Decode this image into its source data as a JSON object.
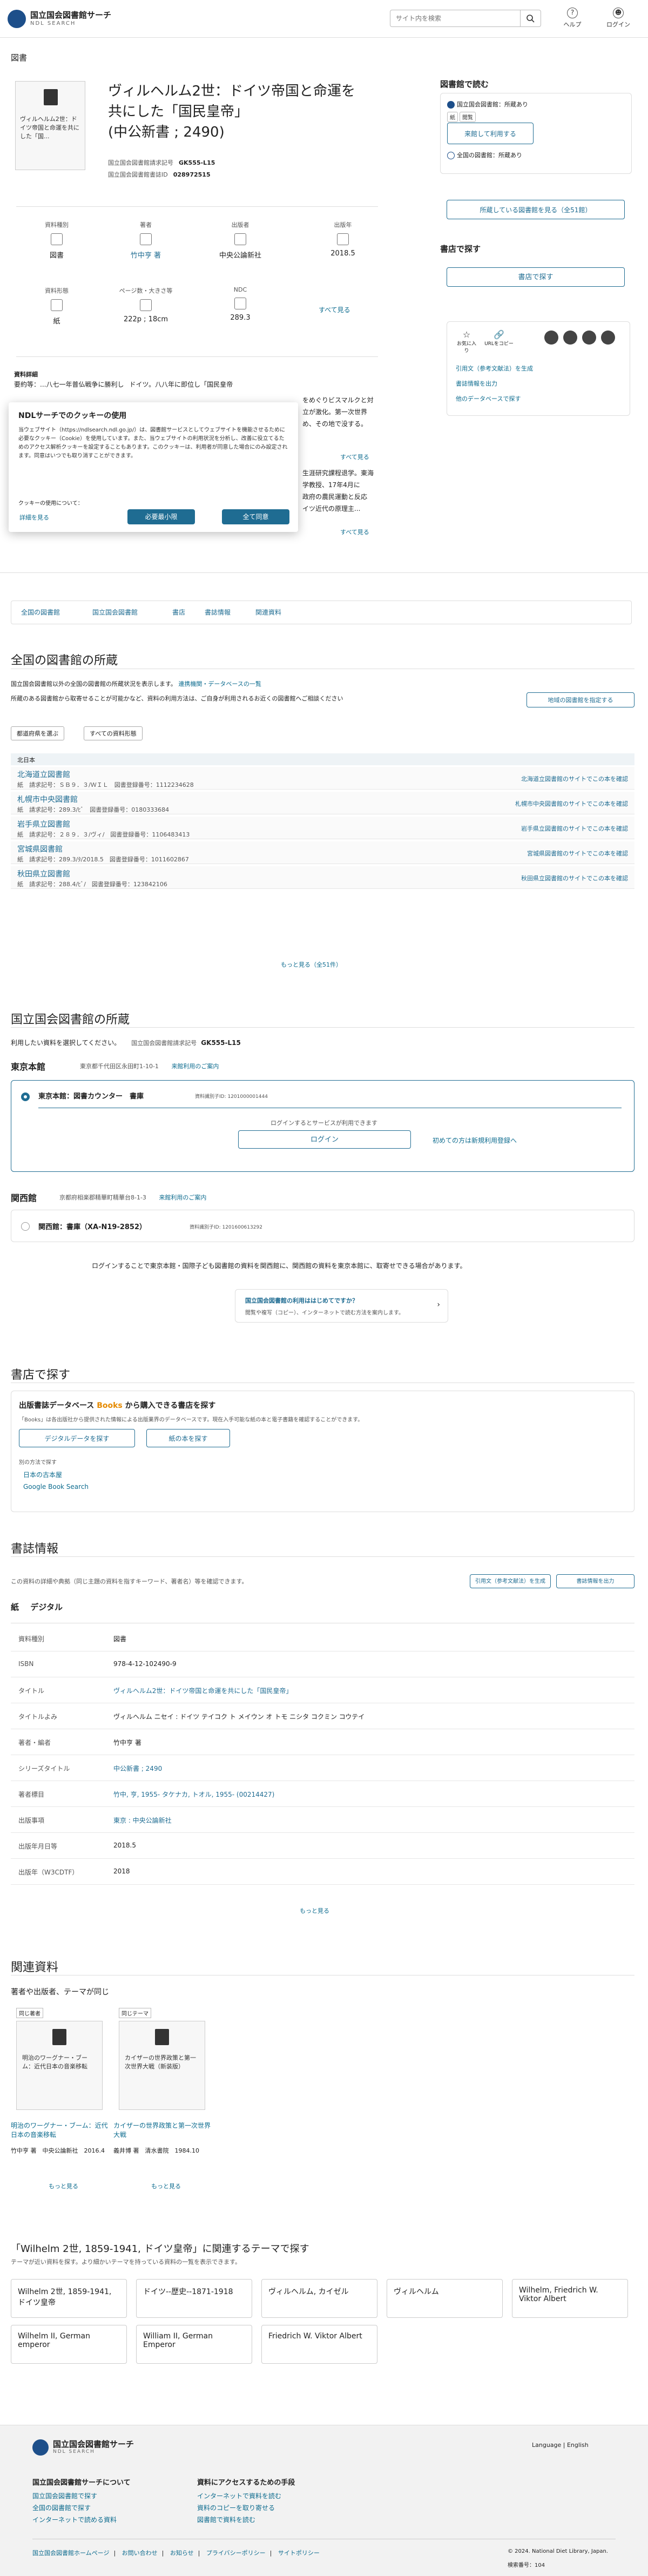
{
  "header": {
    "logo_jp": "国立国会図書館サーチ",
    "logo_en": "NDL SEARCH",
    "search_placeholder": "サイト内を検索",
    "help": "ヘルプ",
    "login": "ログイン"
  },
  "breadcrumb": "図書",
  "item": {
    "thumb_text": "ヴィルヘルム2世：ドイツ帝国と命運を共にした「国...",
    "title_l1": "ヴィルヘルム2世：ドイツ帝国と命運を",
    "title_l2": "共にした「国民皇帝」",
    "title_l3": "(中公新書 ; 2490)",
    "call_label": "国立国会図書館請求記号",
    "call_value": "GK555-L15",
    "ndlid_label": "国立国会図書館書誌ID",
    "ndlid_value": "028972515"
  },
  "info": [
    {
      "label": "資料種別",
      "value": "図書"
    },
    {
      "label": "著者",
      "value": "竹中亨 著"
    },
    {
      "label": "出版者",
      "value": "中央公論新社"
    },
    {
      "label": "出版年",
      "value": "2018.5"
    },
    {
      "label": "資料形態",
      "value": "紙"
    },
    {
      "label": "ページ数・大きさ等",
      "value": "222p ; 18cm"
    },
    {
      "label": "NDC",
      "value": "289.3"
    }
  ],
  "show_all": "すべて見る",
  "abstract": {
    "label": "資料詳細",
    "text1": "要約等：",
    "text2": "...八七一年普仏戦争に勝利し",
    "text3": "ドイツ。八八年に即位し「国民皇帝",
    "r1": "をめぐりビスマルクと対",
    "r2": "立が激化。第一次世界",
    "r3": "め、その地で没する。",
    "more1": "すべて見る",
    "r4": "生涯研究課程退学。東海",
    "r5": "学教授、17年4月に",
    "r6": "政府の農民運動と反応",
    "r7": "イツ近代の原理主...",
    "more2": "すべて見る"
  },
  "cookie": {
    "title": "NDLサーチでのクッキーの使用",
    "body": "当ウェブサイト（https://ndlsearch.ndl.go.jp/）は、図書館サービスとしてウェブサイトを機能させるために必要なクッキー（Cookie）を使用しています。また、当ウェブサイトの利用状況を分析し、改善に役立てるためのアクセス解析クッキーを設定することもあります。このクッキーは、利用者が同意した場合にのみ設定されます。同意はいつでも取り消すことができます。",
    "usage": "クッキーの使用について：",
    "detail": "詳細を見る",
    "necessary": "必要最小限",
    "accept": "全て同意"
  },
  "side": {
    "read_title": "図書館で読む",
    "ndl_label": "国立国会図書館：所蔵あり",
    "tags": [
      "紙",
      "閲覧"
    ],
    "ndl_btn": "来館して利用する",
    "pub_label": "全国の図書館：所蔵あり",
    "pub_btn": "所蔵している図書館を見る（全51館）",
    "buy_title": "書店で探す",
    "buy_btn": "書店で探す",
    "share_labels": [
      "お気に入り",
      "URLをコピー"
    ],
    "cite1": "引用文（参考文献法）を生成",
    "cite2": "書誌情報を出力",
    "cite3": "他のデータベースで探す"
  },
  "tabs": [
    "全国の図書館",
    "国立国会図書館",
    "書店",
    "書誌情報",
    "関連資料"
  ],
  "libs": {
    "title": "全国の図書館の所蔵",
    "desc": "国立国会図書館以外の全国の図書館の所蔵状況を表示します。",
    "link": "連携機関・データベースの一覧",
    "desc2": "所蔵のある図書館から取寄せることが可能かなど、資料の利用方法は、ご自身が利用されるお近くの図書館へご相談ください",
    "area_btn": "地域の図書館を指定する",
    "filter1": "都道府県を選ぶ",
    "filter2": "すべての資料形態",
    "region": "北日本",
    "rows": [
      {
        "name": "北海道立図書館",
        "sub": "紙　請求記号：ＳＢ９．３/ＷＩＬ　図書登録番号：1112234628",
        "link": "北海道立図書館のサイトでこの本を確認"
      },
      {
        "name": "札幌市中央図書館",
        "sub": "紙　請求記号：289.3/ﾋﾞ　図書登録番号：0180333684",
        "link": "札幌市中央図書館のサイトでこの本を確認"
      },
      {
        "name": "岩手県立図書館",
        "sub": "紙　請求記号：２８９．３/ヴィ/　図書登録番号：1106483413",
        "link": "岩手県立図書館のサイトでこの本を確認"
      },
      {
        "name": "宮城県図書館",
        "sub": "紙　請求記号：289.3/ﾀ/2018.5　図書登録番号：1011602867",
        "link": "宮城県図書館のサイトでこの本を確認"
      },
      {
        "name": "秋田県立図書館",
        "sub": "紙　請求記号：288.4/ﾋﾞ/　図書登録番号：123842106",
        "link": "秋田県立図書館のサイトでこの本を確認"
      }
    ],
    "more": "もっと見る（全51件）"
  },
  "ndl": {
    "title": "国立国会図書館の所蔵",
    "desc": "利用したい資料を選択してください。",
    "call_label": "国立国会図書館請求記号",
    "call": "GK555-L15",
    "tokyo": "東京本館",
    "tokyo_addr": "東京都千代田区永田町1-10-1",
    "guide": "来館利用のご案内",
    "tokyo_item": "東京本館：図書カウンター　書庫",
    "tokyo_id": "資料識別子ID: 1201000001444",
    "login_note": "ログインするとサービスが利用できます",
    "login_btn": "ログイン",
    "register": "初めての方は新規利用登録へ",
    "kansai": "関西館",
    "kansai_addr": "京都府相楽郡精華町精華台8-1-3",
    "guide2": "来館利用のご案内",
    "kansai_item": "関西館：書庫（XA-N19-2852）",
    "kansai_id": "資料識別子ID: 1201600613292",
    "note": "ログインすることで東京本館・国際子ども図書館の資料を関西館に、関西館の資料を東京本館に、取寄せできる場合があります。",
    "card_title": "国立国会図書館の利用ははじめてですか？",
    "card_sub": "閲覧や複写（コピー）、インターネットで読む方法を案内します。"
  },
  "store": {
    "title": "書店で探す",
    "subtitle": "出版書誌データベース",
    "books": "Books",
    "subtitle2": "から購入できる書店を探す",
    "desc": "「Books」は各出版社から提供された情報による出版業界のデータベースです。現在入手可能な紙の本と電子書籍を確認することができます。",
    "btn1": "デジタルデータを探す",
    "btn2": "紙の本を探す",
    "other": "別の方法で探す",
    "l1": "日本の古本屋",
    "l2": "Google Book Search"
  },
  "biblio": {
    "title": "書誌情報",
    "desc": "この資料の詳細や典拠（同じ主題の資料を指すキーワード、著者名）等を確認できます。",
    "cite": "引用文（参考文献法）を生成",
    "export": "書誌情報を出力",
    "form1": "紙",
    "form2": "デジタル",
    "rows": [
      {
        "k": "資料種別",
        "v": "図書"
      },
      {
        "k": "ISBN",
        "v": "978-4-12-102490-9"
      },
      {
        "k": "タイトル",
        "v": "ヴィルヘルム2世：ドイツ帝国と命運を共にした「国民皇帝」"
      },
      {
        "k": "タイトルよみ",
        "v": "ヴィルヘルム ニセイ : ドイツ テイコク ト メイウン オ トモ ニシタ コクミン コウテイ"
      },
      {
        "k": "著者・編者",
        "v": "竹中亨 著"
      },
      {
        "k": "シリーズタイトル",
        "v": "中公新書 ; 2490"
      },
      {
        "k": "著者標目",
        "v": "竹中, 亨, 1955- タケナカ, トオル, 1955- (00214427)"
      },
      {
        "k": "出版事項",
        "v": "東京 : 中央公論新社"
      },
      {
        "k": "出版年月日等",
        "v": "2018.5"
      },
      {
        "k": "出版年（W3CDTF）",
        "v": "2018"
      }
    ],
    "more": "もっと見る"
  },
  "related": {
    "title": "関連資料",
    "sub": "著者や出版者、テーマが同じ",
    "c1_tag": "同じ著者",
    "c1_thumb": "明治のワーグナー・ブーム：近代日本の音楽移転",
    "c1_title": "明治のワーグナー・ブーム：近代日本の音楽移転",
    "c1_meta": "竹中亨 著　中央公論新社　2016.4",
    "c2_tag": "同じテーマ",
    "c2_thumb": "カイザーの世界政策と第一次世界大戦（新装版）",
    "c2_title": "カイザーの世界政策と第一次世界大戦",
    "c2_meta": "義井博 著　清水書院　1984.10",
    "more1": "もっと見る",
    "more2": "もっと見る"
  },
  "theme": {
    "title": "「Wilhelm 2世, 1859-1941, ドイツ皇帝」に関連するテーマで探す",
    "desc": "テーマが近い資料を探す。より細かいテーマを持っている資料の一覧を表示できます。",
    "items": [
      "Wilhelm 2世, 1859-1941, ドイツ皇帝",
      "ドイツ--歴史--1871-1918",
      "ヴィルヘルム, カイゼル",
      "ヴィルヘルム",
      "Wilhelm, Friedrich W. Viktor Albert",
      "Wilhelm II, German emperor",
      "William II, German Emperor",
      "Friedrich W. Viktor Albert"
    ]
  },
  "footer": {
    "logo": "国立国会図書館サーチ",
    "logo_en": "NDL SEARCH",
    "lang": "Language | English",
    "col1": "国立国会図書館サーチについて",
    "col1_items": [
      "国立国会図書館で探す",
      "全国の図書館で探す",
      "インターネットで読める資料"
    ],
    "col2": "資料にアクセスするための手段",
    "col2_items": [
      "インターネットで資料を読む",
      "資料のコピーを取り寄せる",
      "図書館で資料を読む"
    ],
    "links": [
      "国立国会図書館ホームページ",
      "お問い合わせ",
      "お知らせ",
      "プライバシーポリシー",
      "サイトポリシー"
    ],
    "copyright": "© 2024. National Diet Library, Japan.",
    "version": "検索番号：104"
  }
}
